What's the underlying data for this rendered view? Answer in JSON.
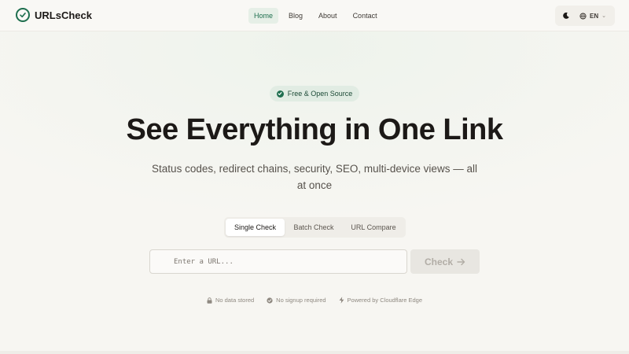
{
  "brand": {
    "name": "URLsCheck",
    "icon": "check-circle-icon",
    "color": "#1f6f4f"
  },
  "nav": {
    "items": [
      {
        "label": "Home",
        "active": true
      },
      {
        "label": "Blog",
        "active": false
      },
      {
        "label": "About",
        "active": false
      },
      {
        "label": "Contact",
        "active": false
      }
    ]
  },
  "tools": {
    "theme_icon": "moon-icon",
    "language_icon": "globe-icon",
    "language": "EN"
  },
  "hero": {
    "badge": "Free & Open Source",
    "title": "See Everything in One Link",
    "subtitle": "Status codes, redirect chains, security, SEO, multi-device views — all at once"
  },
  "tabs": [
    {
      "label": "Single Check",
      "active": true
    },
    {
      "label": "Batch Check",
      "active": false
    },
    {
      "label": "URL Compare",
      "active": false
    }
  ],
  "search": {
    "placeholder": "Enter a URL...",
    "value": "",
    "button_label": "Check"
  },
  "features": [
    {
      "icon": "lock-icon",
      "label": "No data stored"
    },
    {
      "icon": "check-circle-icon",
      "label": "No signup required"
    },
    {
      "icon": "lightning-icon",
      "label": "Powered by Cloudflare Edge"
    }
  ],
  "colors": {
    "accent": "#1f6f4f",
    "background": "#f7f6f2",
    "badge_bg": "#e1ece3"
  }
}
